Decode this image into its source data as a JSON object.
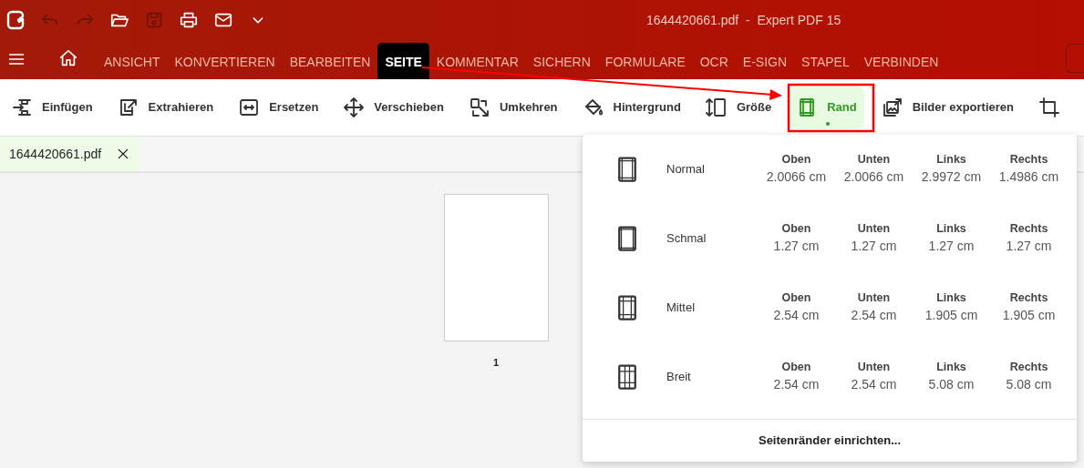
{
  "title_bar": {
    "quick_tools": [
      {
        "kind": "undo",
        "disabled": true
      },
      {
        "kind": "redo",
        "disabled": true
      },
      {
        "kind": "open",
        "disabled": false
      },
      {
        "kind": "save",
        "disabled": true
      },
      {
        "kind": "print",
        "disabled": false
      },
      {
        "kind": "mail",
        "disabled": false
      },
      {
        "kind": "more",
        "disabled": false
      }
    ],
    "title": "1644420661.pdf  -  Expert PDF 15"
  },
  "menu_tabs": [
    {
      "label": "ANSICHT",
      "selected": false
    },
    {
      "label": "KONVERTIEREN",
      "selected": false
    },
    {
      "label": "BEARBEITEN",
      "selected": false
    },
    {
      "label": "SEITE",
      "selected": true
    },
    {
      "label": "KOMMENTAR",
      "selected": false
    },
    {
      "label": "SICHERN",
      "selected": false
    },
    {
      "label": "FORMULARE",
      "selected": false
    },
    {
      "label": "OCR",
      "selected": false
    },
    {
      "label": "E-SIGN",
      "selected": false
    },
    {
      "label": "STAPEL",
      "selected": false
    },
    {
      "label": "VERBINDEN",
      "selected": false
    }
  ],
  "ribbon": [
    {
      "label": "Einfügen",
      "selected": false
    },
    {
      "label": "Extrahieren",
      "selected": false
    },
    {
      "label": "Ersetzen",
      "selected": false
    },
    {
      "label": "Verschieben",
      "selected": false
    },
    {
      "label": "Umkehren",
      "selected": false
    },
    {
      "label": "Hintergrund",
      "selected": false
    },
    {
      "label": "Größe",
      "selected": false
    },
    {
      "label": "Rand",
      "selected": true
    },
    {
      "label": "Bilder exportieren",
      "selected": false
    },
    {
      "selected": false
    }
  ],
  "document_tabs": [
    {
      "label": "1644420661.pdf",
      "selected": true
    }
  ],
  "page_thumbnail": {
    "label": "1"
  },
  "margins_menu": {
    "options": [
      {
        "name": "Normal",
        "values": [
          {
            "label": "Oben",
            "value": "2.0066 cm"
          },
          {
            "label": "Unten",
            "value": "2.0066 cm"
          },
          {
            "label": "Links",
            "value": "2.9972 cm"
          },
          {
            "label": "Rechts",
            "value": "1.4986 cm"
          }
        ]
      },
      {
        "name": "Schmal",
        "values": [
          {
            "label": "Oben",
            "value": "1.27 cm"
          },
          {
            "label": "Unten",
            "value": "1.27 cm"
          },
          {
            "label": "Links",
            "value": "1.27 cm"
          },
          {
            "label": "Rechts",
            "value": "1.27 cm"
          }
        ]
      },
      {
        "name": "Mittel",
        "values": [
          {
            "label": "Oben",
            "value": "2.54 cm"
          },
          {
            "label": "Unten",
            "value": "2.54 cm"
          },
          {
            "label": "Links",
            "value": "1.905 cm"
          },
          {
            "label": "Rechts",
            "value": "1.905 cm"
          }
        ]
      },
      {
        "name": "Breit",
        "values": [
          {
            "label": "Oben",
            "value": "2.54 cm"
          },
          {
            "label": "Unten",
            "value": "2.54 cm"
          },
          {
            "label": "Links",
            "value": "5.08 cm"
          },
          {
            "label": "Rechts",
            "value": "5.08 cm"
          }
        ]
      }
    ],
    "footer": "Seitenränder einrichten..."
  }
}
